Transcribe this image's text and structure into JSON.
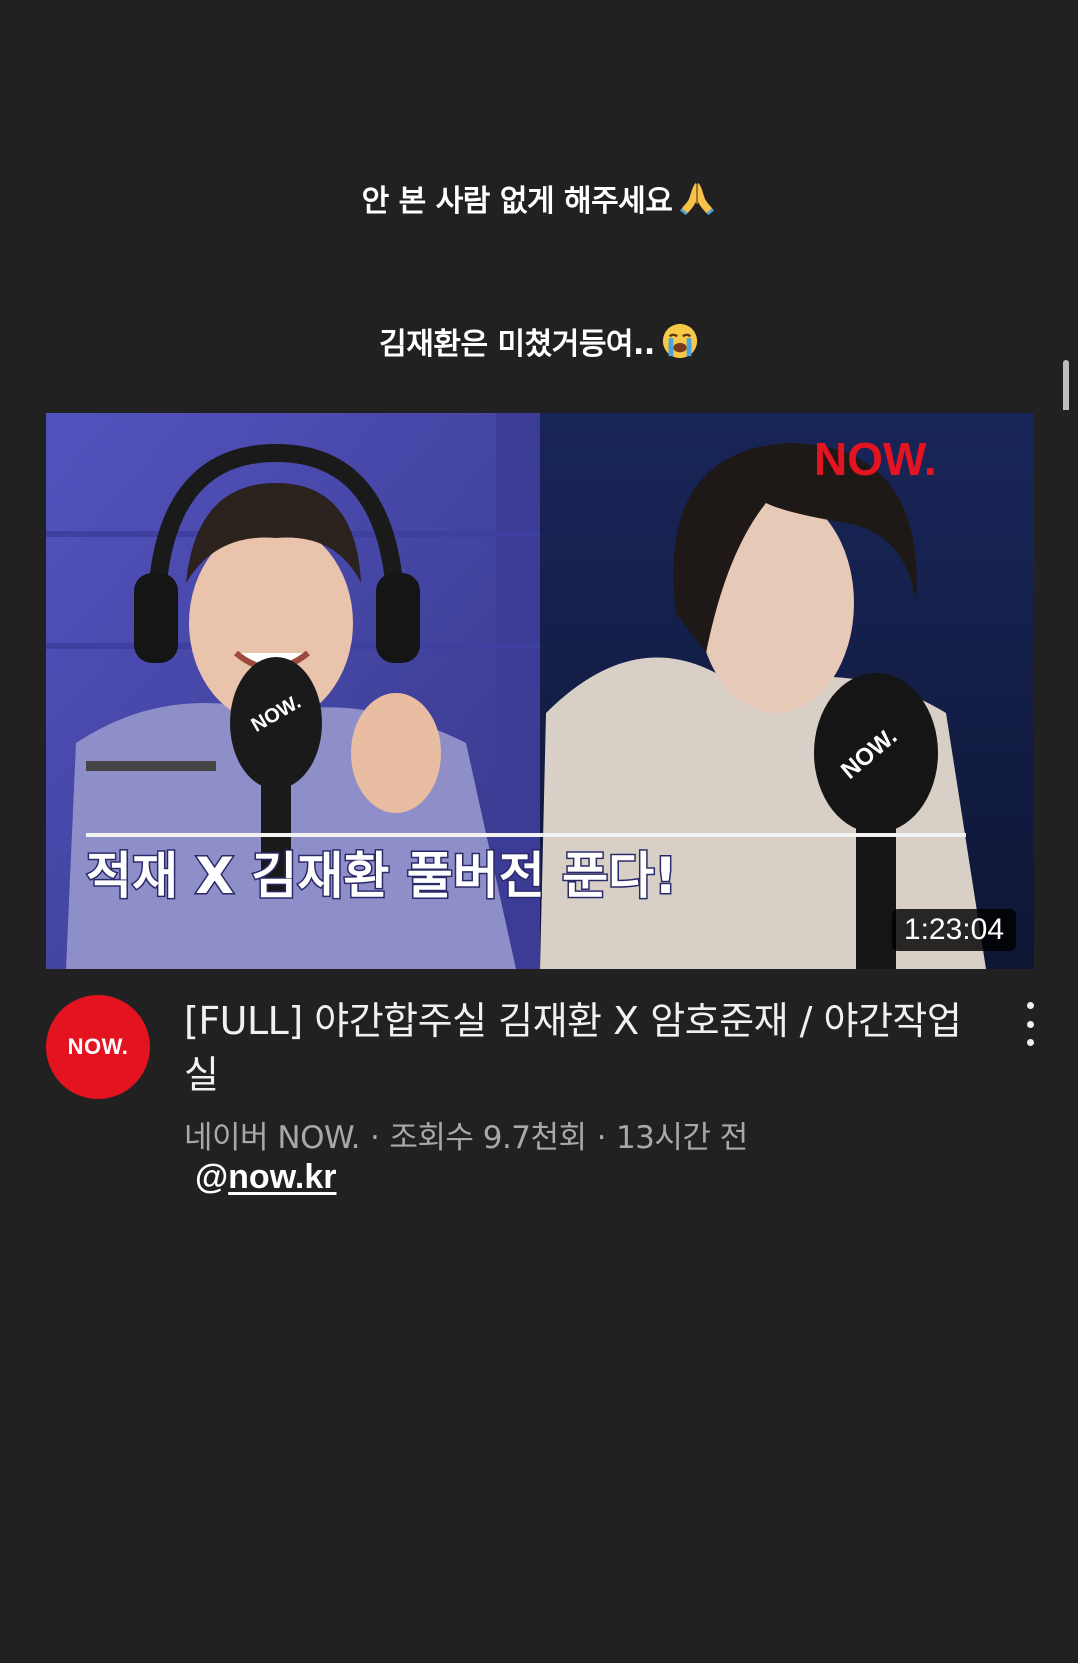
{
  "story": {
    "caption_1": "안 본 사람 없게 해주세요",
    "caption_1_emoji": "folded-hands-emoji",
    "caption_2": "김재환은 미쳤거등여..",
    "caption_2_emoji": "crying-face-emoji"
  },
  "video": {
    "thumbnail_brand": "NOW.",
    "thumbnail_caption": "적재 X 김재환 풀버전 푼다!",
    "mic_label": "NOW.",
    "duration": "1:23:04",
    "title": "[FULL] 야간합주실 김재환 X 암호준재 / 야간작업실",
    "channel_name": "네이버 NOW.",
    "views": "조회수 9.7천회",
    "age": "13시간 전",
    "channel_logo_text": "NOW."
  },
  "mention": {
    "at": "@",
    "handle": "now.kr"
  },
  "colors": {
    "background": "#212121",
    "brand_red": "#e3141f",
    "meta_gray": "#a8a8a8"
  }
}
